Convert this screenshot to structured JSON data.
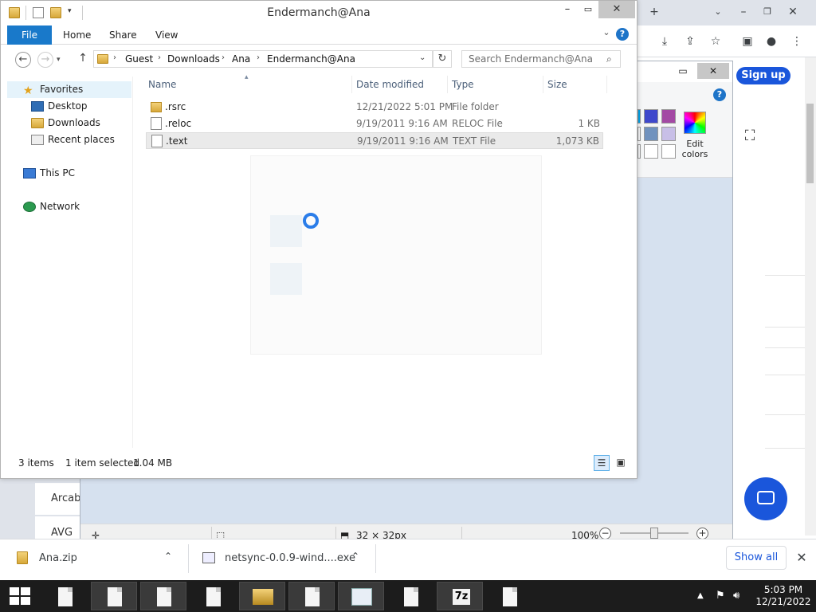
{
  "explorer": {
    "title": "Endermanch@Ana",
    "tabs": {
      "file": "File",
      "home": "Home",
      "share": "Share",
      "view": "View"
    },
    "help": "?",
    "breadcrumbs": [
      "Guest",
      "Downloads",
      "Ana",
      "Endermanch@Ana"
    ],
    "search_placeholder": "Search Endermanch@Ana",
    "nav": {
      "favorites": "Favorites",
      "desktop": "Desktop",
      "downloads": "Downloads",
      "recent": "Recent places",
      "this_pc": "This PC",
      "network": "Network"
    },
    "columns": {
      "name": "Name",
      "date": "Date modified",
      "type": "Type",
      "size": "Size"
    },
    "files": [
      {
        "name": ".rsrc",
        "date": "12/21/2022 5:01 PM",
        "type": "File folder",
        "size": ""
      },
      {
        "name": ".reloc",
        "date": "9/19/2011 9:16 AM",
        "type": "RELOC File",
        "size": "1 KB"
      },
      {
        "name": ".text",
        "date": "9/19/2011 9:16 AM",
        "type": "TEXT File",
        "size": "1,073 KB"
      }
    ],
    "status": {
      "count": "3 items",
      "selected": "1 item selected",
      "size": "1.04 MB"
    }
  },
  "paint": {
    "edit_colors": "Edit colors",
    "help": "?",
    "dimensions": "32 × 32px",
    "zoom": "100%",
    "swatch_colors": [
      "#3f48cc",
      "#a349a4",
      "#7092be",
      "#c8bfe7",
      "#ffffff",
      "#ffffff"
    ]
  },
  "browser": {
    "signup": "Sign up",
    "list_items": [
      "Arcabi",
      "AVG"
    ]
  },
  "downloads": {
    "items": [
      "Ana.zip",
      "netsync-0.0.9-wind....exe"
    ],
    "show_all": "Show all"
  },
  "taskbar": {
    "time": "5:03 PM",
    "date": "12/21/2022",
    "sevenzip_label": "7z"
  }
}
